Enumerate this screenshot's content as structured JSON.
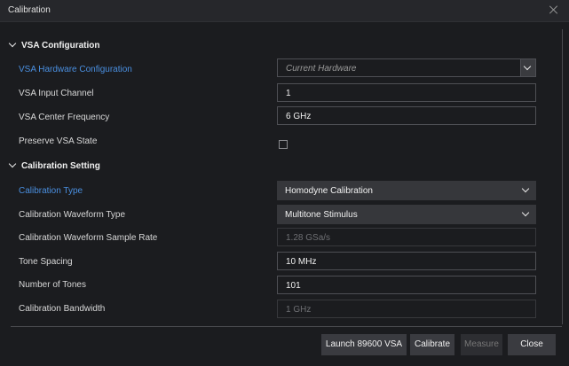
{
  "window": {
    "title": "Calibration"
  },
  "vsa_section": {
    "title": "VSA Configuration",
    "hardware_config": {
      "label": "VSA Hardware Configuration",
      "value": "Current Hardware"
    },
    "input_channel": {
      "label": "VSA Input Channel",
      "value": "1"
    },
    "center_freq": {
      "label": "VSA Center Frequency",
      "value": "6 GHz"
    },
    "preserve_state": {
      "label": "Preserve VSA State",
      "checked": false
    }
  },
  "cal_section": {
    "title": "Calibration Setting",
    "cal_type": {
      "label": "Calibration Type",
      "value": "Homodyne Calibration"
    },
    "waveform_type": {
      "label": "Calibration Waveform Type",
      "value": "Multitone Stimulus"
    },
    "sample_rate": {
      "label": "Calibration Waveform Sample Rate",
      "value": "1.28 GSa/s"
    },
    "tone_spacing": {
      "label": "Tone Spacing",
      "value": "10 MHz"
    },
    "num_tones": {
      "label": "Number of Tones",
      "value": "101"
    },
    "bandwidth": {
      "label": "Calibration Bandwidth",
      "value": "1 GHz"
    }
  },
  "footer": {
    "launch": "Launch 89600 VSA",
    "calibrate": "Calibrate",
    "measure": "Measure",
    "close": "Close"
  },
  "colors": {
    "accent_link": "#4a8fe0",
    "background": "#1b1c1f",
    "button": "#3a3b40"
  }
}
